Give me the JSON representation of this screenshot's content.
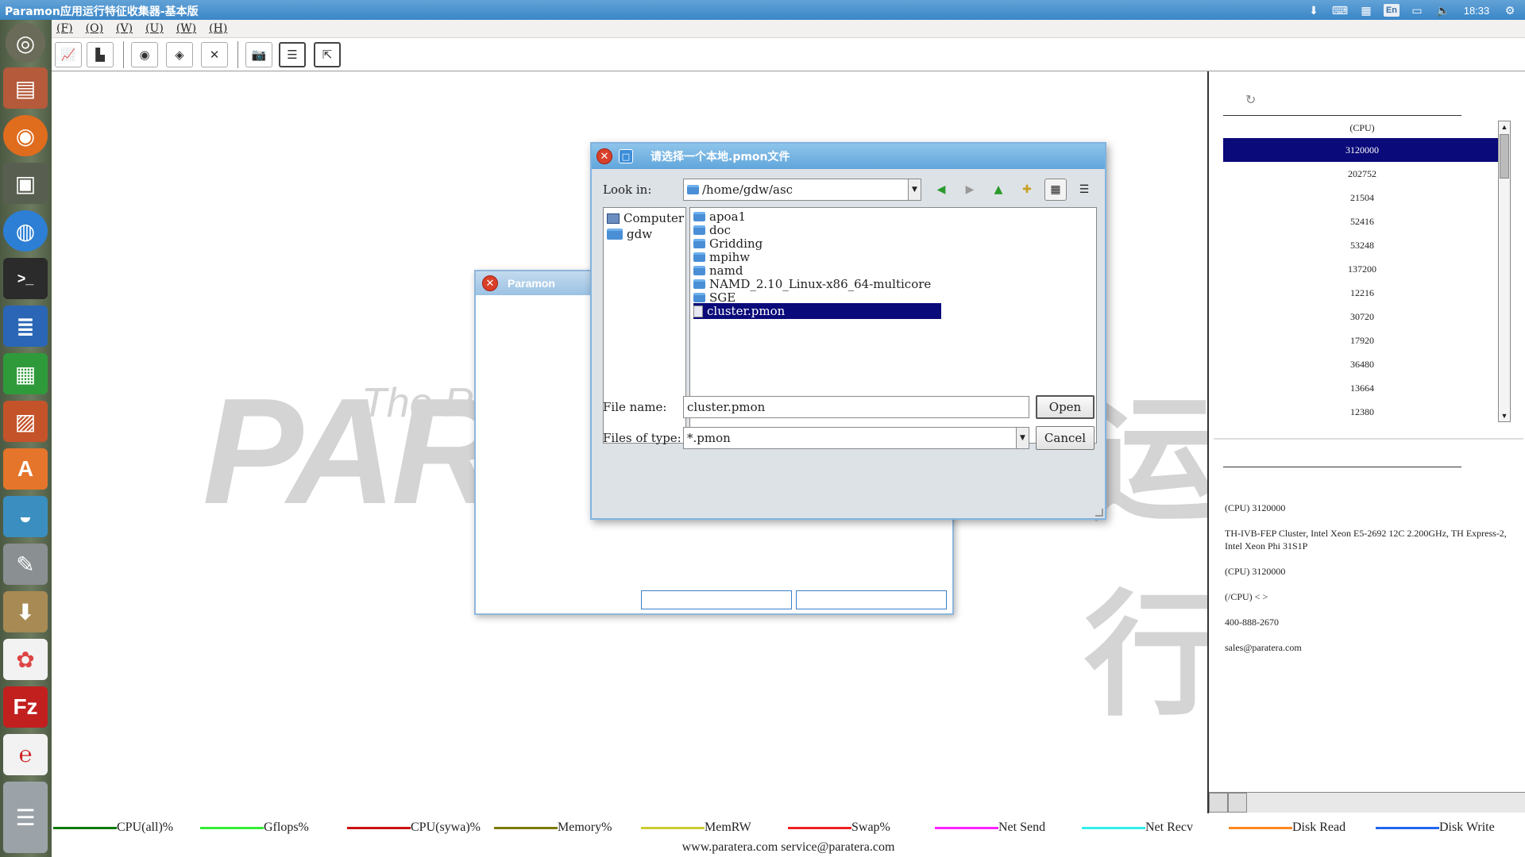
{
  "topbar": {
    "title": "Paramon应用运行特征收集器-基本版",
    "tray_icons": [
      "download-icon",
      "keyboard-icon",
      "calendar-icon",
      "input-method-icon",
      "battery-icon",
      "volume-icon",
      "settings-gear-icon"
    ],
    "input_method": "En",
    "clock": "18:33"
  },
  "launcher": {
    "items": [
      "ubuntu-dash-icon",
      "files-icon",
      "firefox-icon",
      "workspace-icon",
      "chromium-icon",
      "terminal-icon",
      "writer-icon",
      "calc-icon",
      "impress-icon",
      "software-center-icon",
      "drive-icon",
      "system-settings-icon",
      "archive-manager-icon",
      "app-icon",
      "filezilla-icon",
      "app-red-icon",
      "trash-stack-icon"
    ]
  },
  "menubar": {
    "items": [
      "(F)",
      "(O)",
      "(V)",
      "(U)",
      "(W)",
      "(H)"
    ]
  },
  "toolbar": {
    "buttons": [
      "chart-icon",
      "bar-chart-icon",
      "eye-icon",
      "tag-icon",
      "cross-icon",
      "camera-icon",
      "list-icon",
      "export-icon"
    ]
  },
  "watermark": {
    "big_text": "PAR",
    "tagline": "The Ri",
    "chinese_fragment": "运行"
  },
  "paramon_dialog": {
    "title": "Paramon"
  },
  "file_dialog": {
    "title": "请选择一个本地.pmon文件",
    "look_in_label": "Look in:",
    "look_in_value": "/home/gdw/asc",
    "sidebar": [
      {
        "label": "Computer",
        "icon": "computer-icon"
      },
      {
        "label": "gdw",
        "icon": "folder-icon"
      }
    ],
    "files": [
      {
        "name": "apoa1",
        "type": "folder"
      },
      {
        "name": "doc",
        "type": "folder"
      },
      {
        "name": "Gridding",
        "type": "folder"
      },
      {
        "name": "mpihw",
        "type": "folder"
      },
      {
        "name": "namd",
        "type": "folder"
      },
      {
        "name": "NAMD_2.10_Linux-x86_64-multicore",
        "type": "folder"
      },
      {
        "name": "SGE",
        "type": "folder"
      },
      {
        "name": "cluster.pmon",
        "type": "file",
        "selected": true
      }
    ],
    "file_name_label": "File name:",
    "file_name_value": "cluster.pmon",
    "files_of_type_label": "Files of type:",
    "files_of_type_value": "*.pmon",
    "open_label": "Open",
    "cancel_label": "Cancel"
  },
  "right_panel": {
    "cpu_header": "(CPU)",
    "cpu_values": [
      "3120000",
      "202752",
      "21504",
      "52416",
      "53248",
      "137200",
      "12216",
      "30720",
      "17920",
      "36480",
      "13664",
      "12380"
    ],
    "info": [
      "(CPU) 3120000",
      "TH-IVB-FEP Cluster, Intel Xeon E5-2692 12C 2.200GHz, TH Express-2, Intel Xeon Phi 31S1P",
      "(CPU) 3120000",
      "(/CPU) < >",
      "400-888-2670",
      "sales@paratera.com"
    ]
  },
  "legend": {
    "items": [
      {
        "label": "CPU(all)%",
        "color": "#0a7a0a"
      },
      {
        "label": "Gflops%",
        "color": "#33ee33"
      },
      {
        "label": "CPU(sywa)%",
        "color": "#cc1111"
      },
      {
        "label": "Memory%",
        "color": "#7a7a0a"
      },
      {
        "label": "MemRW",
        "color": "#cccc33"
      },
      {
        "label": "Swap%",
        "color": "#ee2222"
      },
      {
        "label": "Net Send",
        "color": "#ff22ff"
      },
      {
        "label": "Net Recv",
        "color": "#33eeee"
      },
      {
        "label": "Disk Read",
        "color": "#ff8822"
      },
      {
        "label": "Disk Write",
        "color": "#2266ee"
      }
    ],
    "footer": "www.paratera.com service@paratera.com"
  }
}
